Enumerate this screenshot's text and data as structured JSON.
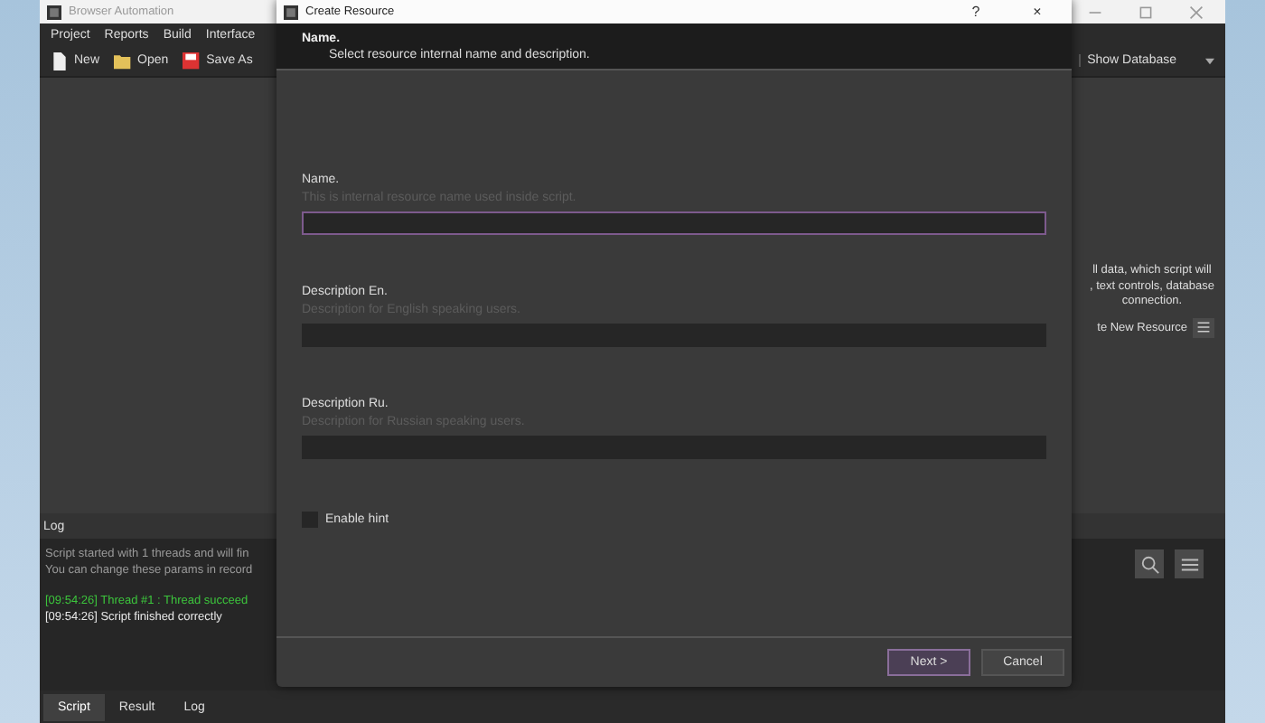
{
  "main_window": {
    "title": "Browser Automation",
    "menu": [
      "Project",
      "Reports",
      "Build",
      "Interface"
    ],
    "toolbar": [
      {
        "label": "New",
        "kind": "new"
      },
      {
        "label": "Open",
        "kind": "open"
      },
      {
        "label": "Save As",
        "kind": "save"
      }
    ],
    "database_button": "Show Database",
    "side_text": [
      "ll data, which script will",
      ", text controls, database",
      "connection."
    ],
    "create_button": "te New Resource",
    "log": {
      "title": "Log",
      "lines": [
        {
          "text": "Script started with 1 threads and will fin",
          "color": "#9a9a9a"
        },
        {
          "text": "You can change these params in record",
          "color": "#9a9a9a"
        },
        {
          "text": "[09:54:26] Thread #1 : Thread succeed",
          "color": "#3cc43c"
        },
        {
          "text": "[09:54:26] Script finished correctly",
          "color": "#e8e8e8"
        }
      ]
    },
    "tabs": [
      {
        "label": "Script",
        "selected": true
      },
      {
        "label": "Result",
        "selected": false
      },
      {
        "label": "Log",
        "selected": false
      }
    ]
  },
  "dialog": {
    "title": "Create Resource",
    "help": "?",
    "close": "×",
    "header": {
      "title": "Name.",
      "subtitle": "Select resource internal name and description."
    },
    "fields": [
      {
        "label": "Name.",
        "hint": "This is internal resource name used inside script.",
        "focused": true
      },
      {
        "label": "Description En.",
        "hint": "Description for English speaking users.",
        "focused": false
      },
      {
        "label": "Description Ru.",
        "hint": "Description for Russian speaking users.",
        "focused": false
      }
    ],
    "checkbox": {
      "label": "Enable hint",
      "checked": false
    },
    "buttons": [
      {
        "label": "Next >",
        "default": true
      },
      {
        "label": "Cancel",
        "default": false
      }
    ]
  }
}
